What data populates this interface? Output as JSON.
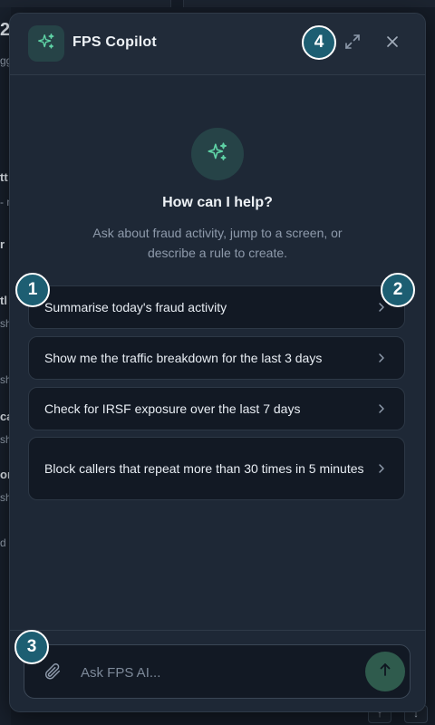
{
  "background": {
    "fragments": [
      "2",
      "gg",
      "tt",
      "- n",
      "r",
      "tl",
      "sh",
      "sh",
      "ca",
      "sh",
      "or",
      "sh",
      "d"
    ],
    "arrows": [
      "↑",
      "↓"
    ]
  },
  "header": {
    "title": "FPS Copilot",
    "logo_icon": "sparkles-icon",
    "expand_icon": "expand-icon",
    "close_icon": "close-icon"
  },
  "hero": {
    "icon": "sparkles-icon",
    "title": "How can I help?",
    "subtitle": "Ask about fraud activity, jump to a screen, or describe a rule to create."
  },
  "suggestions": [
    "Summarise today's fraud activity",
    "Show me the traffic breakdown for the last 3 days",
    "Check for IRSF exposure over the last 7 days",
    "Block callers that repeat more than 30 times in 5 minutes"
  ],
  "composer": {
    "placeholder": "Ask FPS AI...",
    "value": "",
    "attach_icon": "paperclip-icon",
    "send_icon": "arrow-up-icon"
  },
  "markers": [
    "1",
    "2",
    "3",
    "4"
  ],
  "colors": {
    "accent": "#5fd3a6",
    "marker": "#1d5e72",
    "panel": "#1e2836",
    "card": "#121924"
  }
}
